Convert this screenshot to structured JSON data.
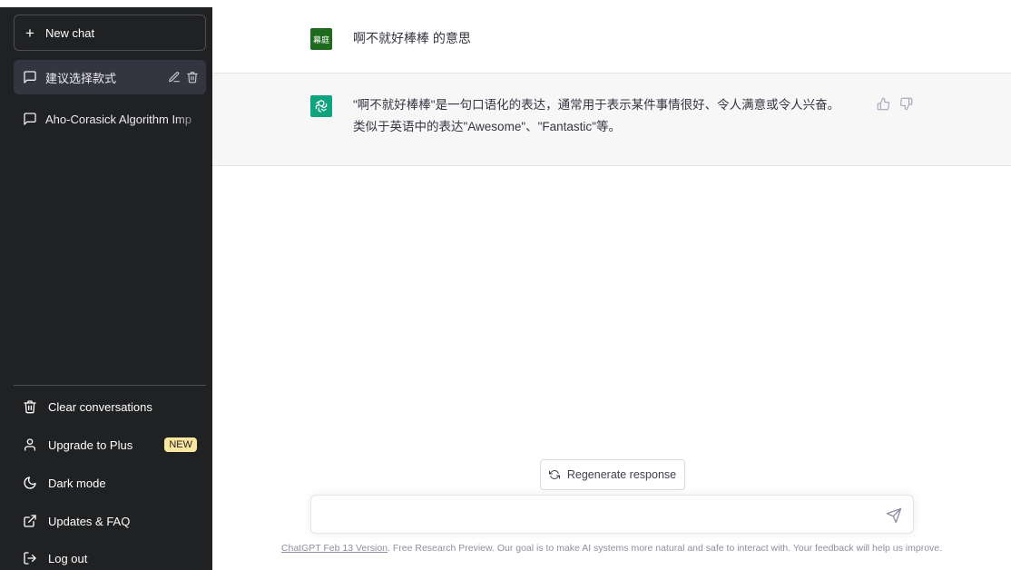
{
  "sidebar": {
    "new_chat": {
      "label": "New chat",
      "icon": "plus-icon"
    },
    "conversations": [
      {
        "title": "建议选择款式",
        "active": true
      },
      {
        "title": "Aho-Corasick Algorithm Imp",
        "active": false
      }
    ],
    "menu": [
      {
        "label": "Clear conversations",
        "icon": "trash-icon"
      },
      {
        "label": "Upgrade to Plus",
        "icon": "user-icon",
        "badge": "NEW"
      },
      {
        "label": "Dark mode",
        "icon": "moon-icon"
      },
      {
        "label": "Updates & FAQ",
        "icon": "external-link-icon"
      },
      {
        "label": "Log out",
        "icon": "logout-icon"
      }
    ]
  },
  "chat": {
    "user_avatar_text": "幕庭",
    "user_message": "啊不就好棒棒 的意思",
    "assistant_message_line1": "\"啊不就好棒棒\"是一句口语化的表达，通常用于表示某件事情很好、令人满意或令人兴奋。",
    "assistant_message_line2": "类似于英语中的表达\"Awesome\"、\"Fantastic\"等。"
  },
  "composer": {
    "regenerate_label": "Regenerate response",
    "input_value": "",
    "input_placeholder": ""
  },
  "footer": {
    "version_link": "ChatGPT Feb 13 Version",
    "text": ". Free Research Preview. Our goal is to make AI systems more natural and safe to interact with. Your feedback will help us improve."
  },
  "colors": {
    "sidebar_bg": "#202123",
    "accent": "#10a37f",
    "user_avatar": "#1e6b1e",
    "badge": "#fae69e"
  }
}
